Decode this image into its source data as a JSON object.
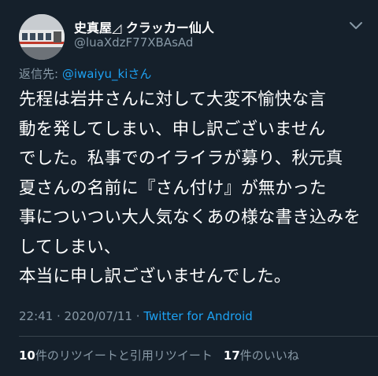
{
  "author": {
    "display_name": "史真屋◿ クラッカー仙人",
    "handle": "@luaXdzF77XBAsAd"
  },
  "reply": {
    "prefix": "返信先: ",
    "mention": "@iwaiyu_ki",
    "suffix": "さん"
  },
  "body_lines": [
    "先程は岩井さんに対して大変不愉快な言",
    "動を発してしまい、申し訳ございません",
    "でした。私事でのイライラが募り、秋元真",
    "夏さんの名前に『さん付け』が無かった",
    "事についつい大人気なくあの様な書き込みを",
    "してしまい、",
    "本当に申し訳ございませんでした。"
  ],
  "meta": {
    "time": "22:41",
    "separator": " · ",
    "date": "2020/07/11",
    "source": "Twitter for Android"
  },
  "stats": {
    "retweets_count": "10",
    "retweets_label": "件のリツイートと引用リツイート",
    "likes_count": "17",
    "likes_label": "件のいいね"
  },
  "colors": {
    "background": "#15202b",
    "text": "#ffffff",
    "secondary": "#8899a6",
    "link": "#1da1f2",
    "divider": "#38444d"
  },
  "icons": {
    "more": "chevron-down-icon"
  }
}
